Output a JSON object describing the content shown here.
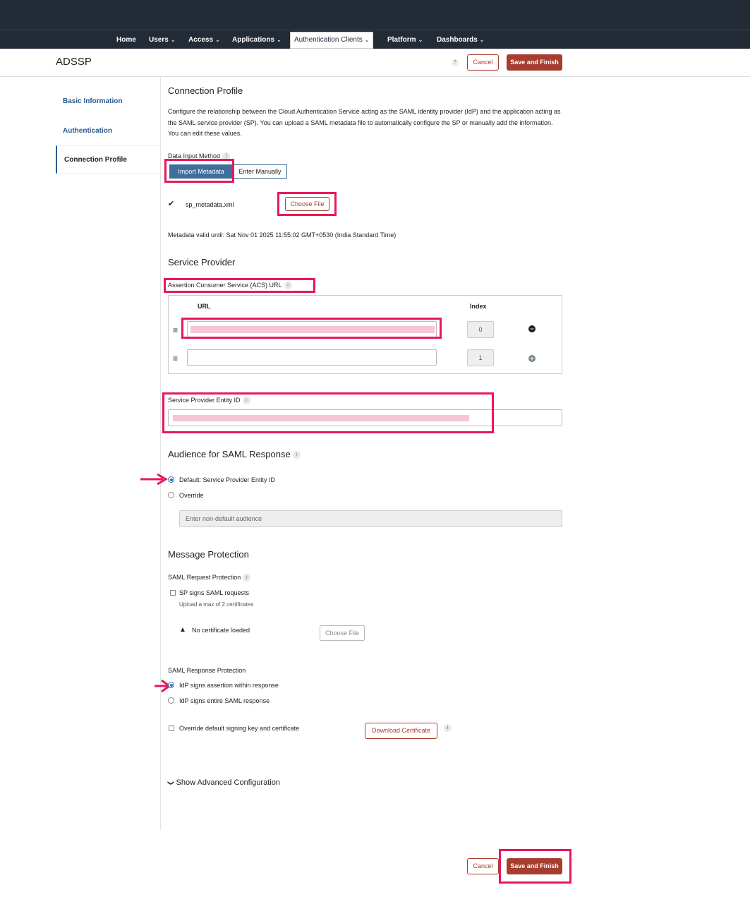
{
  "nav": {
    "items": [
      {
        "label": "Home",
        "chevron": false
      },
      {
        "label": "Users",
        "chevron": true
      },
      {
        "label": "Access",
        "chevron": true
      },
      {
        "label": "Applications",
        "chevron": true
      },
      {
        "label": "Authentication Clients",
        "chevron": true
      },
      {
        "label": "Platform",
        "chevron": true
      },
      {
        "label": "Dashboards",
        "chevron": true
      }
    ],
    "chevron": "⌄"
  },
  "header": {
    "title": "ADSSP",
    "help": "?",
    "cancel": "Cancel",
    "save": "Save and Finish"
  },
  "sidebar": {
    "items": [
      "Basic Information",
      "Authentication",
      "Connection Profile"
    ]
  },
  "connection_profile": {
    "title": "Connection Profile",
    "description": "Configure the relationship between the Cloud Authentication Service acting as the SAML identity provider (IdP) and the application acting as the SAML service provider (SP). You can upload a SAML metadata file to automatically configure the SP or manually add the information. You can edit these values.",
    "data_input_label": "Data Input Method",
    "import_metadata": "Import Metadata",
    "enter_manually": "Enter Manually",
    "file_name": "sp_metadata.xml",
    "choose_file": "Choose File",
    "metadata_valid": "Metadata valid until: Sat Nov 01 2025 11:55:02 GMT+0530 (India Standard Time)"
  },
  "service_provider": {
    "title": "Service Provider",
    "acs_label": "Assertion Consumer Service (ACS) URL",
    "col_url": "URL",
    "col_index": "Index",
    "rows": [
      {
        "url": "",
        "index": "0",
        "action": "−"
      },
      {
        "url": "",
        "index": "1",
        "action": "+"
      }
    ],
    "entity_id_label": "Service Provider Entity ID",
    "handle": "≡"
  },
  "audience": {
    "title": "Audience for SAML Response",
    "default_option": "Default: Service Provider Entity ID",
    "override_option": "Override",
    "placeholder": "Enter non-default audience"
  },
  "message_protection": {
    "title": "Message Protection",
    "request_label": "SAML Request Protection",
    "sp_signs": "SP signs SAML requests",
    "upload_hint": "Upload a max of 2 certificates",
    "no_cert": "No certificate loaded",
    "choose_file": "Choose File",
    "response_label": "SAML Response Protection",
    "idp_assertion": "IdP signs assertion within response",
    "idp_entire": "IdP signs entire SAML response",
    "override_key": "Override default signing key and certificate",
    "download_cert": "Download Certificate"
  },
  "advanced": {
    "label": "Show Advanced Configuration"
  },
  "footer": {
    "cancel": "Cancel",
    "save": "Save and Finish"
  },
  "icons": {
    "info": "i",
    "check": "✔",
    "warning": "▲",
    "chevron_down": "❯"
  },
  "colors": {
    "nav_bg": "#232b36",
    "accent": "#a63d2f",
    "primary": "#3d6e9c",
    "highlight": "#e8185a"
  }
}
